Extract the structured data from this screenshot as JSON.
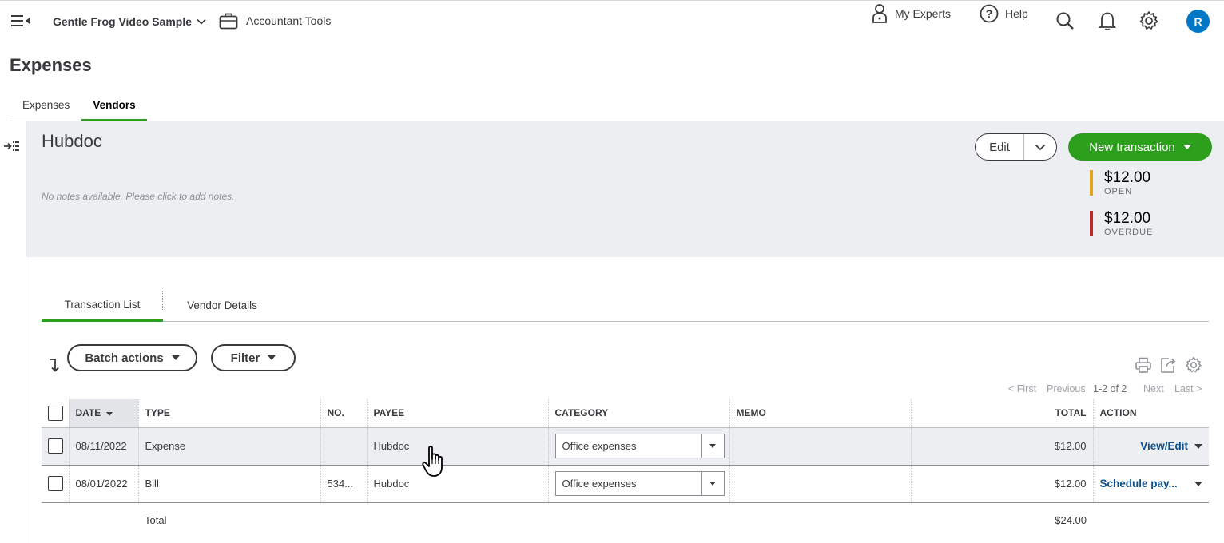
{
  "topbar": {
    "company": "Gentle Frog Video Sample",
    "accountant_tools": "Accountant Tools",
    "my_experts": "My Experts",
    "help": "Help",
    "avatar_initial": "R"
  },
  "page_title": "Expenses",
  "tabs": [
    {
      "label": "Expenses",
      "active": false
    },
    {
      "label": "Vendors",
      "active": true
    }
  ],
  "vendor": {
    "name": "Hubdoc",
    "notes_placeholder": "No notes available. Please click to add notes.",
    "edit_label": "Edit",
    "new_transaction_label": "New transaction",
    "stats": [
      {
        "amount": "$12.00",
        "label": "OPEN",
        "color": "#e8a317"
      },
      {
        "amount": "$12.00",
        "label": "OVERDUE",
        "color": "#c0282d"
      }
    ]
  },
  "sub_tabs": [
    {
      "label": "Transaction List",
      "active": true
    },
    {
      "label": "Vendor Details",
      "active": false
    }
  ],
  "toolbar": {
    "batch_actions": "Batch actions",
    "filter": "Filter"
  },
  "pager": {
    "first": "< First",
    "previous": "Previous",
    "range": "1-2 of 2",
    "next": "Next",
    "last": "Last >"
  },
  "table": {
    "headers": {
      "date": "DATE",
      "type": "TYPE",
      "no": "NO.",
      "payee": "PAYEE",
      "category": "CATEGORY",
      "memo": "MEMO",
      "total": "TOTAL",
      "action": "ACTION"
    },
    "rows": [
      {
        "date": "08/11/2022",
        "type": "Expense",
        "no": "",
        "payee": "Hubdoc",
        "category": "Office expenses",
        "memo": "",
        "total": "$12.00",
        "action": "View/Edit"
      },
      {
        "date": "08/01/2022",
        "type": "Bill",
        "no": "534...",
        "payee": "Hubdoc",
        "category": "Office expenses",
        "memo": "",
        "total": "$12.00",
        "action": "Schedule pay..."
      }
    ],
    "total_label": "Total",
    "total_value": "$24.00"
  },
  "colors": {
    "brand_green": "#2ca01c",
    "link_blue": "#0d4f8b",
    "avatar_blue": "#0077c5"
  }
}
